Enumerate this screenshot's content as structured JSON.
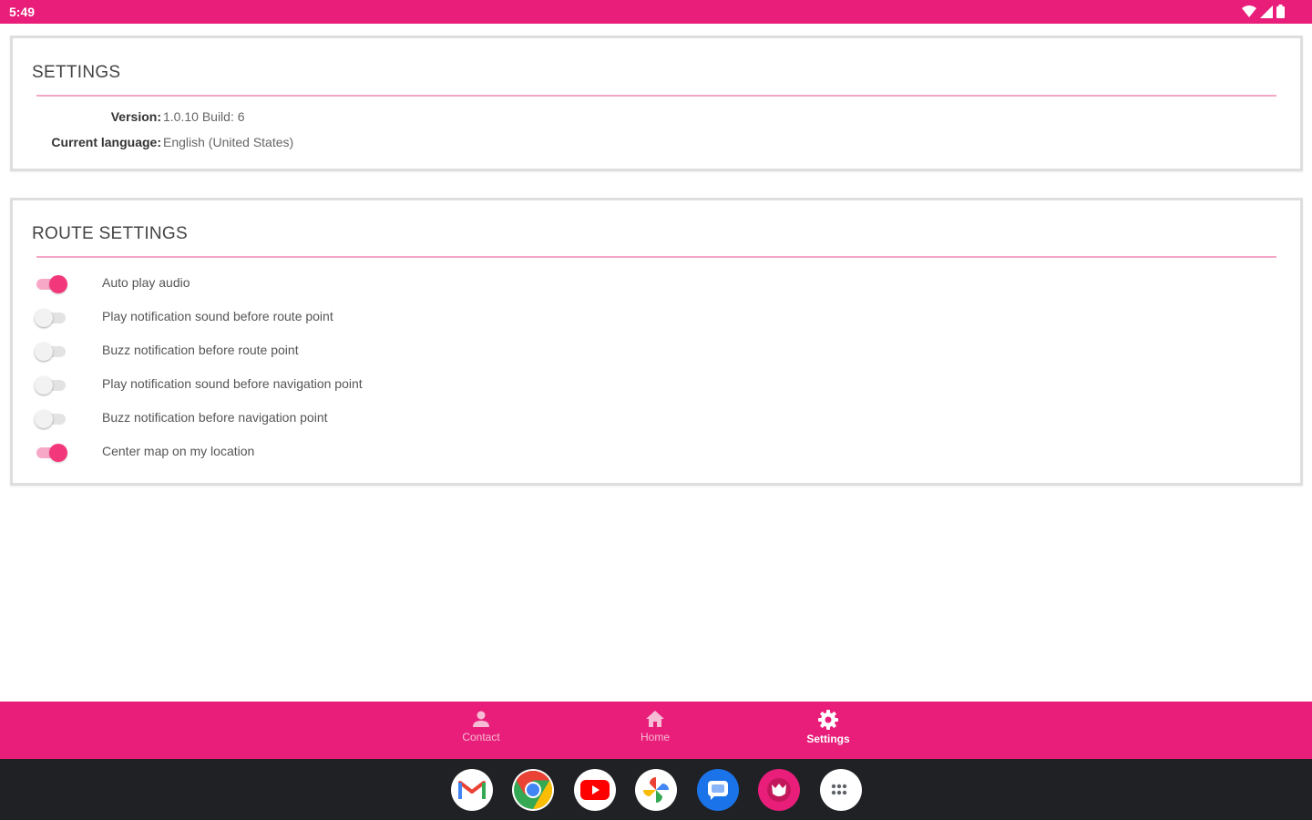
{
  "status_bar": {
    "time": "5:49"
  },
  "settings_card": {
    "title": "SETTINGS",
    "rows": [
      {
        "label": "Version",
        "value": "1.0.10 Build: 6"
      },
      {
        "label": "Current language",
        "value": "English (United States)"
      }
    ]
  },
  "route_card": {
    "title": "ROUTE SETTINGS",
    "toggles": [
      {
        "label": "Auto play audio",
        "on": true
      },
      {
        "label": "Play notification sound before route point",
        "on": false
      },
      {
        "label": "Buzz notification before route point",
        "on": false
      },
      {
        "label": "Play notification sound before navigation point",
        "on": false
      },
      {
        "label": "Buzz notification before navigation point",
        "on": false
      },
      {
        "label": "Center map on my location",
        "on": true
      }
    ]
  },
  "bottom_nav": {
    "items": [
      {
        "label": "Contact",
        "icon": "person-icon",
        "active": false
      },
      {
        "label": "Home",
        "icon": "home-icon",
        "active": false
      },
      {
        "label": "Settings",
        "icon": "gear-icon",
        "active": true
      }
    ]
  },
  "dock": {
    "apps": [
      "gmail-icon",
      "chrome-icon",
      "youtube-icon",
      "photos-icon",
      "messages-icon",
      "app-icon",
      "app-drawer-icon"
    ]
  },
  "colors": {
    "accent": "#e91e7a",
    "toggle_on": "#f2387a",
    "divider": "#f3a6c6",
    "taskbar": "#202124"
  }
}
